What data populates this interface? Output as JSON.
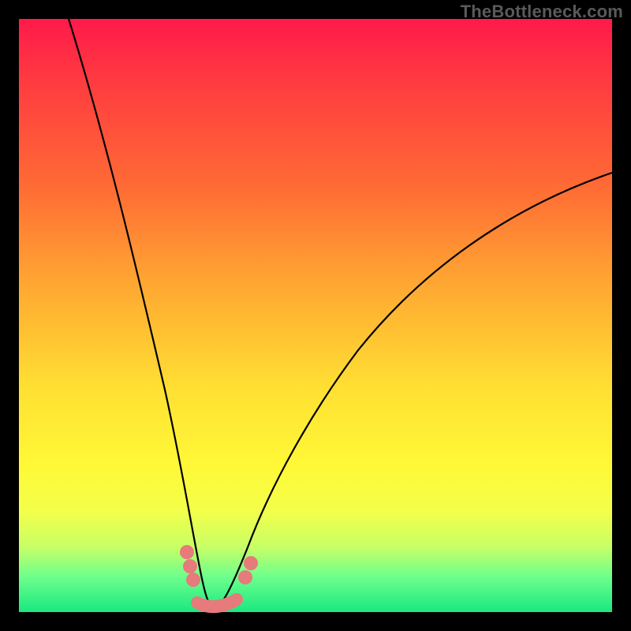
{
  "watermark": "TheBottleneck.com",
  "colors": {
    "page_bg": "#000000",
    "gradient_top": "#ff1a4a",
    "gradient_bottom": "#19e880",
    "curve": "#000000",
    "beads": "#e77a7a"
  },
  "chart_data": {
    "type": "line",
    "title": "",
    "xlabel": "",
    "ylabel": "",
    "xlim": [
      0,
      100
    ],
    "ylim": [
      0,
      100
    ],
    "grid": false,
    "legend": false,
    "description": "V-shaped bottleneck curve: steep descent from top-left to a minimum near x≈30, then a more gradual ascent toward the upper-right. Lower y is better (green zone); higher y is worse (red zone).",
    "series": [
      {
        "name": "left-branch",
        "x": [
          5,
          10,
          14,
          18,
          22,
          25,
          27,
          28.5,
          30
        ],
        "y": [
          100,
          84,
          70,
          55,
          38,
          22,
          12,
          6,
          1
        ]
      },
      {
        "name": "right-branch",
        "x": [
          30,
          33,
          37,
          42,
          50,
          60,
          72,
          85,
          100
        ],
        "y": [
          1,
          7,
          15,
          24,
          36,
          48,
          58,
          66,
          72
        ]
      }
    ],
    "markers": {
      "name": "beads",
      "x": [
        25.5,
        26.5,
        27.5,
        29,
        31,
        33,
        34.5,
        35.5
      ],
      "y": [
        14,
        11,
        8,
        2,
        2,
        6,
        9,
        12
      ]
    }
  }
}
